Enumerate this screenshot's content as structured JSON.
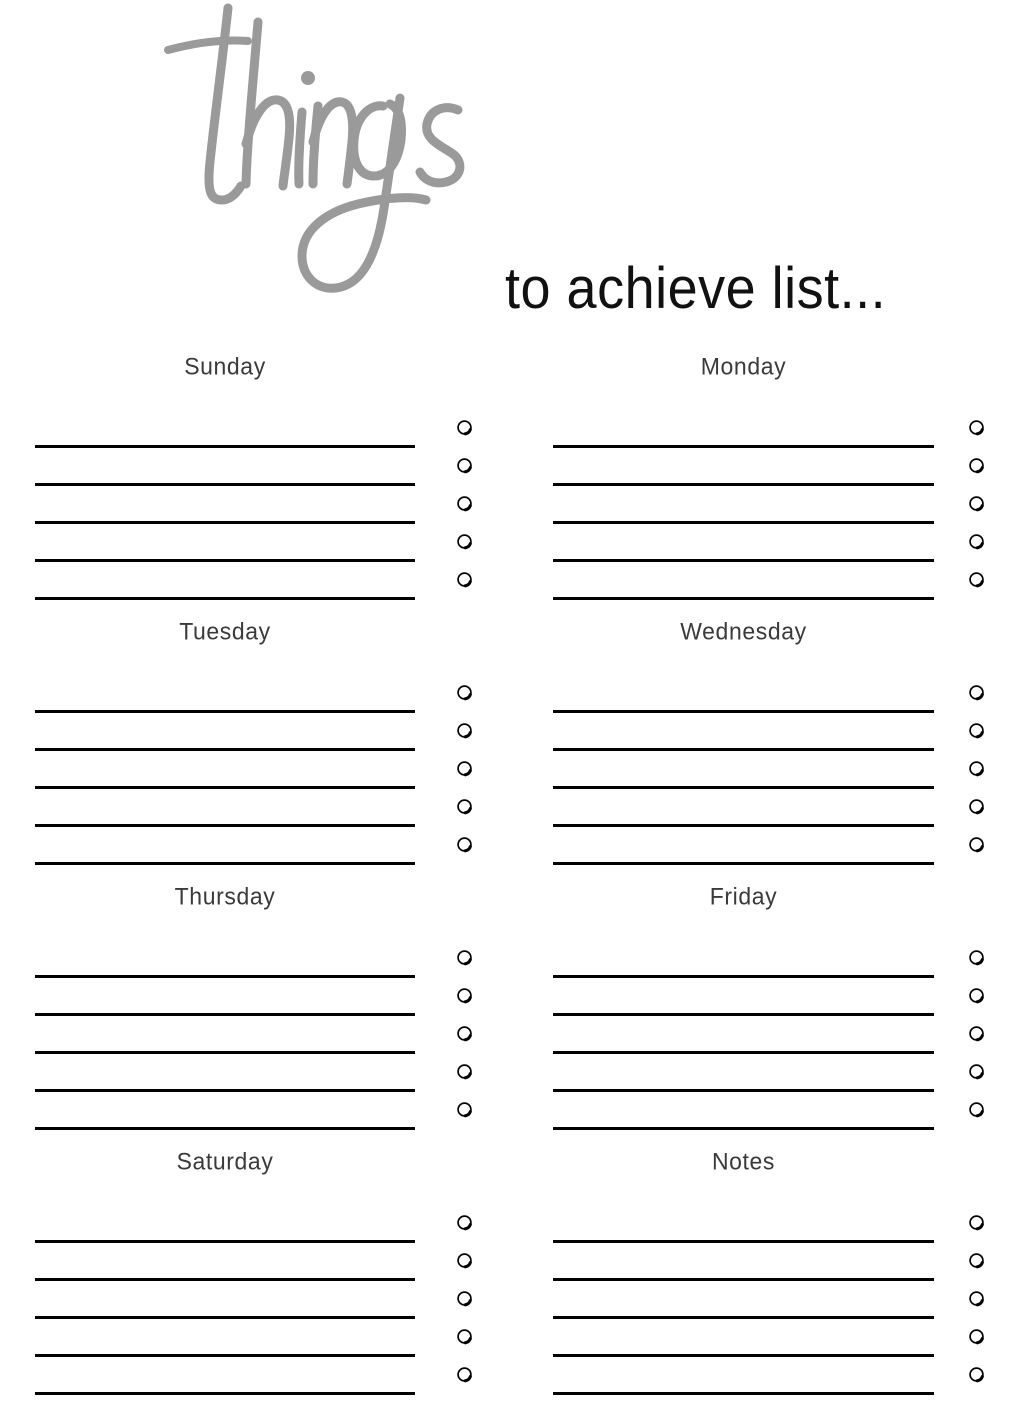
{
  "header": {
    "script_word": "things",
    "subtitle": "to achieve list...",
    "script_color": "#9a9a9a",
    "subtitle_color": "#111111"
  },
  "theme": {
    "page_background": "#ffffff",
    "rule_line_color": "#000000",
    "bullet_stroke_color": "#000000",
    "section_title_color": "#3a3a3a"
  },
  "layout": {
    "columns": 2,
    "rows": 4,
    "lines_per_section": 5,
    "bullets_per_section": 5
  },
  "sections": [
    {
      "title": "Sunday",
      "column": "left",
      "row": 1,
      "lines": [
        "",
        "",
        "",
        "",
        ""
      ],
      "bullets": [
        false,
        false,
        false,
        false,
        false
      ]
    },
    {
      "title": "Monday",
      "column": "right",
      "row": 1,
      "lines": [
        "",
        "",
        "",
        "",
        ""
      ],
      "bullets": [
        false,
        false,
        false,
        false,
        false
      ]
    },
    {
      "title": "Tuesday",
      "column": "left",
      "row": 2,
      "lines": [
        "",
        "",
        "",
        "",
        ""
      ],
      "bullets": [
        false,
        false,
        false,
        false,
        false
      ]
    },
    {
      "title": "Wednesday",
      "column": "right",
      "row": 2,
      "lines": [
        "",
        "",
        "",
        "",
        ""
      ],
      "bullets": [
        false,
        false,
        false,
        false,
        false
      ]
    },
    {
      "title": "Thursday",
      "column": "left",
      "row": 3,
      "lines": [
        "",
        "",
        "",
        "",
        ""
      ],
      "bullets": [
        false,
        false,
        false,
        false,
        false
      ]
    },
    {
      "title": "Friday",
      "column": "right",
      "row": 3,
      "lines": [
        "",
        "",
        "",
        "",
        ""
      ],
      "bullets": [
        false,
        false,
        false,
        false,
        false
      ]
    },
    {
      "title": "Saturday",
      "column": "left",
      "row": 4,
      "lines": [
        "",
        "",
        "",
        "",
        ""
      ],
      "bullets": [
        false,
        false,
        false,
        false,
        false
      ]
    },
    {
      "title": "Notes",
      "column": "right",
      "row": 4,
      "lines": [
        "",
        "",
        "",
        "",
        ""
      ],
      "bullets": [
        false,
        false,
        false,
        false,
        false
      ]
    }
  ],
  "icons": {
    "bullet": "circle-checkbox-icon",
    "script": "handwritten-script-icon"
  }
}
